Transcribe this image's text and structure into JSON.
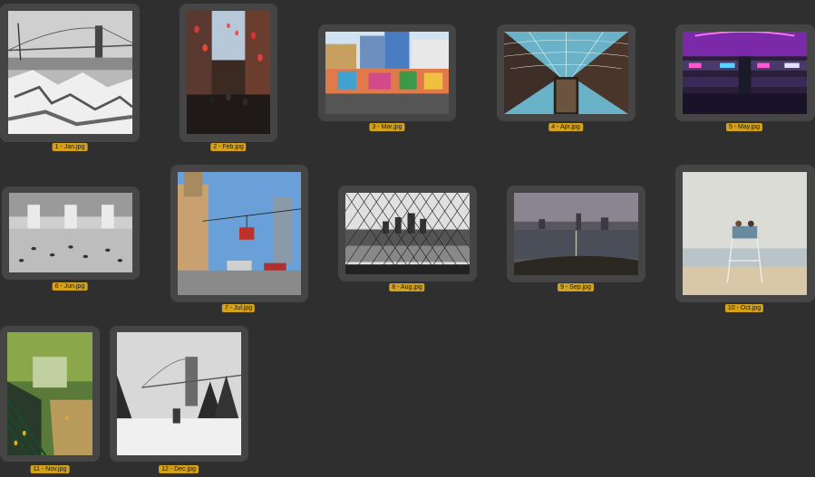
{
  "files": [
    {
      "id": "jan",
      "label": "1 - Jan.jpg",
      "icon": "bridge-snow-photo-icon"
    },
    {
      "id": "feb",
      "label": "2 - Feb.jpg",
      "icon": "street-lanterns-photo-icon"
    },
    {
      "id": "mar",
      "label": "3 - Mar.jpg",
      "icon": "graffiti-wall-photo-icon"
    },
    {
      "id": "apr",
      "label": "4 - Apr.jpg",
      "icon": "glass-dome-photo-icon"
    },
    {
      "id": "may",
      "label": "5 - May.jpg",
      "icon": "neon-mall-photo-icon"
    },
    {
      "id": "jun",
      "label": "6 - Jun.jpg",
      "icon": "grand-hall-photo-icon"
    },
    {
      "id": "jul",
      "label": "7 - Jul.jpg",
      "icon": "tramway-street-photo-icon"
    },
    {
      "id": "aug",
      "label": "8 - Aug.jpg",
      "icon": "fence-skyline-photo-icon"
    },
    {
      "id": "sep",
      "label": "9 - Sep.jpg",
      "icon": "waterfront-skyline-photo-icon"
    },
    {
      "id": "oct",
      "label": "10 - Oct.jpg",
      "icon": "lifeguard-beach-photo-icon"
    },
    {
      "id": "nov",
      "label": "11 - Nov.jpg",
      "icon": "autumn-park-photo-icon"
    },
    {
      "id": "dec",
      "label": "12 - Dec.jpg",
      "icon": "winter-bridge-photo-icon"
    }
  ],
  "colors": {
    "background": "#2f2f2f",
    "tile": "#454545",
    "label_highlight": "#d3a21c"
  }
}
